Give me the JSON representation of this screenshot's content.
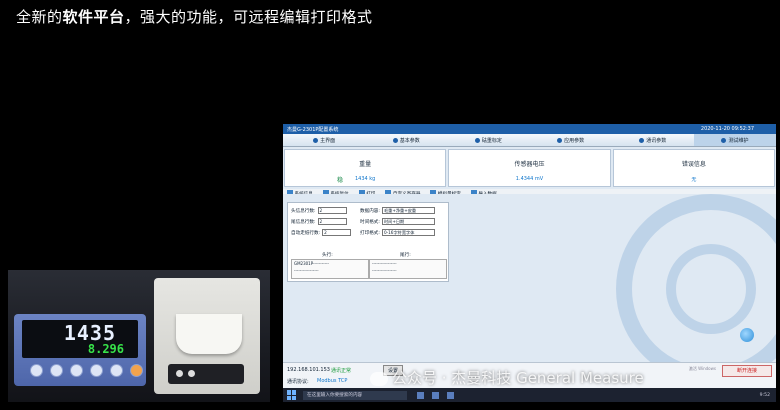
{
  "headline": {
    "part1": "全新的",
    "bold": "软件平台",
    "part2": "，强大的功能，可远程编辑打印格式"
  },
  "photo": {
    "indicator_main": "1435",
    "indicator_unit": "kg",
    "indicator_sub": "8.296"
  },
  "window": {
    "title": "杰曼G-2301P配置系统",
    "time": "2020-11-20 09:52:37",
    "nav": [
      {
        "label": "主界面"
      },
      {
        "label": "基本参数"
      },
      {
        "label": "砝重标定"
      },
      {
        "label": "应用参数"
      },
      {
        "label": "通讯参数"
      },
      {
        "label": "测试维护"
      }
    ],
    "panels": [
      {
        "title": "重量",
        "value": "1434 kg",
        "stable": "稳"
      },
      {
        "title": "传感器电压",
        "value": "1.4344 mV"
      },
      {
        "title": "错误信息",
        "value": "无"
      }
    ],
    "tabs": [
      "系统信息",
      "系统复位",
      "打印",
      "自定义寄存器",
      "模拟量标定",
      "导入数据"
    ],
    "form": {
      "head_lines_label": "头信息行数:",
      "head_lines": "2",
      "tail_lines_label": "尾信息行数:",
      "tail_lines": "2",
      "auto_feed_label": "自动走纸行数:",
      "auto_feed": "2",
      "data_content_label": "数据内容:",
      "data_content": "毛重+净重+皮重",
      "time_format_label": "时间格式:",
      "time_format": "时间+日期",
      "print_format_label": "打印格式:",
      "print_format": "0-16字符宽字体",
      "head_col": "头行:",
      "tail_col": "尾行:",
      "head_line1": "GM2301P-----------",
      "head_line2": "-----------------",
      "tail_line1": "-----------------",
      "tail_line2": "-----------------"
    },
    "status": {
      "ip": "192.168.101.153",
      "conn_status": "通讯正常",
      "settings_btn": "设置",
      "protocol_label": "通讯协议:",
      "protocol": "Modbus TCP",
      "disconnect_btn": "断开连接",
      "activate_hint": "激活 Windows"
    }
  },
  "taskbar": {
    "search_placeholder": "在这里输入你要搜索的内容",
    "time": "9:52"
  },
  "watermark": "公众号 · 杰曼科技 General Measure"
}
